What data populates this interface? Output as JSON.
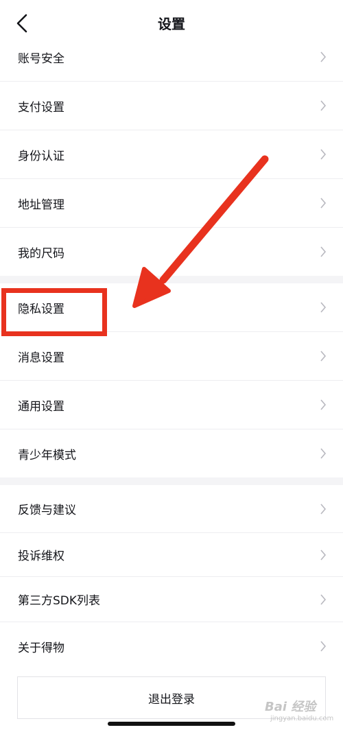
{
  "header": {
    "title": "设置"
  },
  "groups": [
    {
      "items": [
        {
          "label": "账号安全"
        },
        {
          "label": "支付设置"
        },
        {
          "label": "身份认证"
        },
        {
          "label": "地址管理"
        },
        {
          "label": "我的尺码"
        }
      ]
    },
    {
      "items": [
        {
          "label": "隐私设置"
        },
        {
          "label": "消息设置"
        },
        {
          "label": "通用设置"
        },
        {
          "label": "青少年模式"
        }
      ]
    },
    {
      "items": [
        {
          "label": "反馈与建议"
        },
        {
          "label": "投诉维权"
        },
        {
          "label": "第三方SDK列表"
        },
        {
          "label": "关于得物"
        }
      ]
    }
  ],
  "logout": {
    "label": "退出登录"
  },
  "watermark": {
    "main": "Bai 经验",
    "sub": "jingyan.baidu.com"
  },
  "colors": {
    "annotation": "#e8321e",
    "separator": "#f4f4f6"
  }
}
